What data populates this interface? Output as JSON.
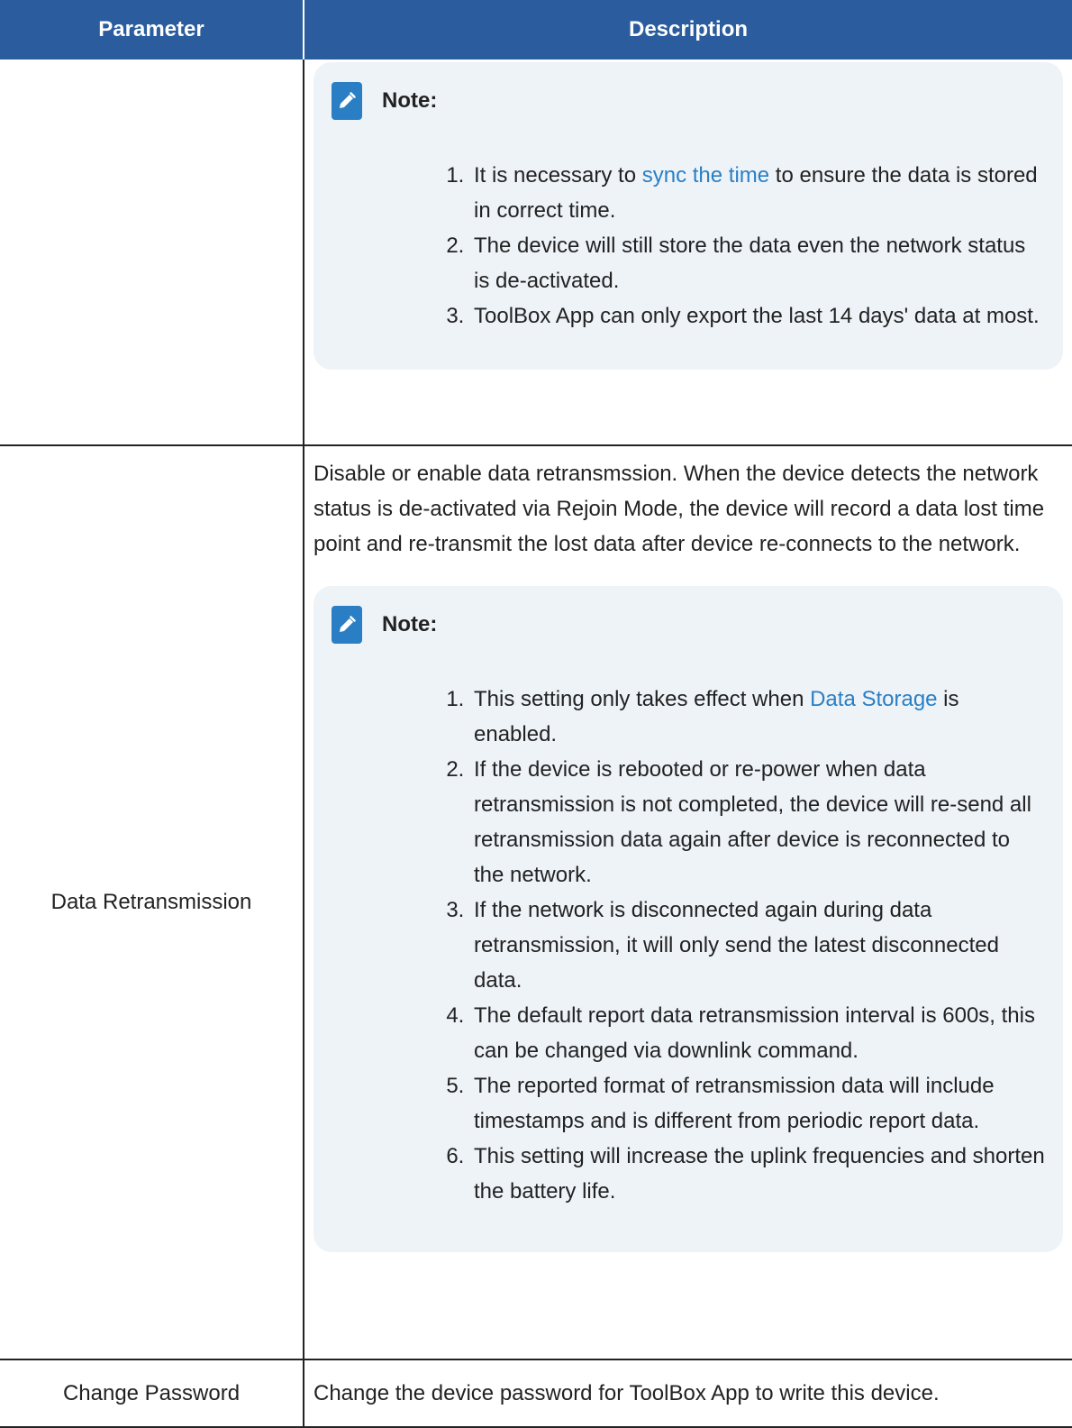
{
  "table": {
    "headers": {
      "parameter": "Parameter",
      "description": "Description"
    },
    "rows": [
      {
        "parameter": "",
        "note": {
          "title": "Note:",
          "items": [
            {
              "pre": "It is necessary to ",
              "link": "sync the time",
              "post": " to ensure the data is stored in correct time."
            },
            {
              "text": "The device will still store the data even the network status is de-activated."
            },
            {
              "text": "ToolBox App can only export the last 14 days' data at most."
            }
          ]
        }
      },
      {
        "parameter": "Data Retransmission",
        "description": "Disable or enable data retransmssion. When the device detects the network status is de-activated via Rejoin Mode, the device will record a data lost time point and re-transmit the lost data after device re-connects to the network.",
        "note": {
          "title": "Note:",
          "items": [
            {
              "pre": "This setting only takes effect when ",
              "link": "Data Storage",
              "post": " is enabled."
            },
            {
              "text": "If the device is rebooted or re-power when data retransmission is not completed, the device will re-send all retransmission data again after device is reconnected to the network."
            },
            {
              "text": "If the network is disconnected again during data retransmission, it will only send the latest disconnected data."
            },
            {
              "text": "The default report data retransmission interval is 600s, this can be changed via downlink command."
            },
            {
              "text": "The reported format of retransmission data will include timestamps and is different from periodic report data."
            },
            {
              "text": "This setting will increase the uplink frequencies and shorten the battery life."
            }
          ]
        }
      },
      {
        "parameter": "Change Password",
        "description": "Change the device password for ToolBox App to write this device."
      }
    ]
  }
}
